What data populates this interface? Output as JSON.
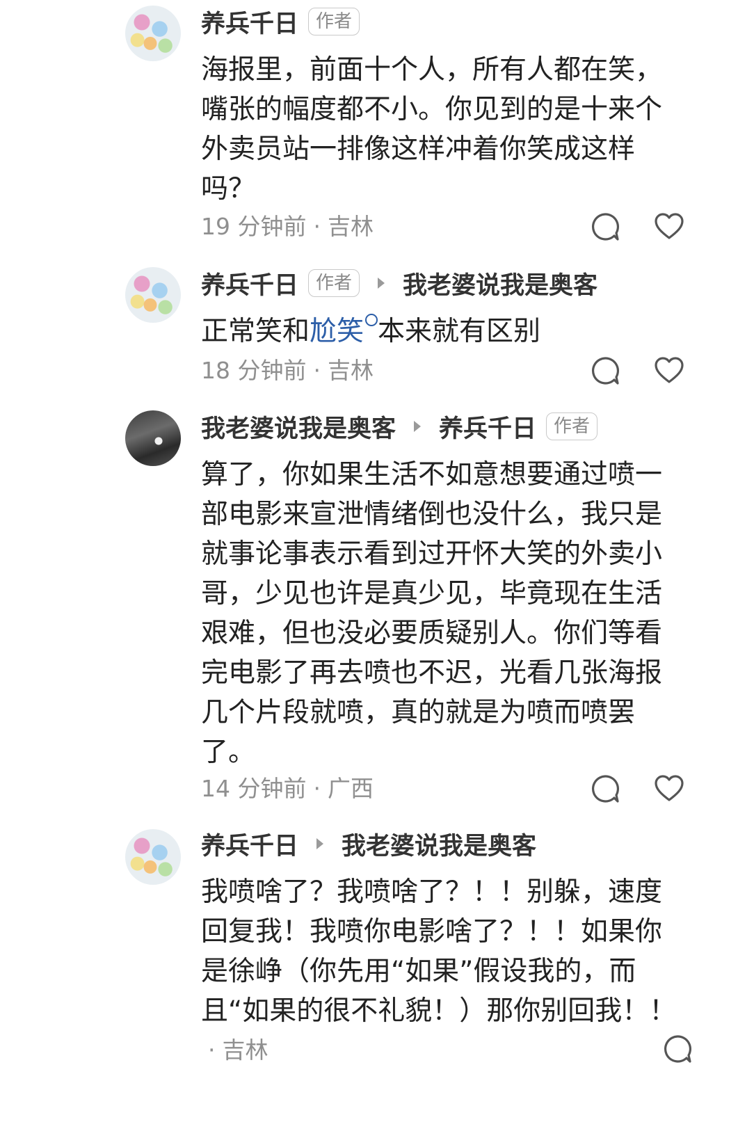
{
  "author_badge": "作者",
  "comments": [
    {
      "user": "养兵千日",
      "author_badge": true,
      "reply_to": "",
      "text": "海报里，前面十个人，所有人都在笑，嘴张的幅度都不小。你见到的是十来个外卖员站一排像这样冲着你笑成这样吗？",
      "time": "19 分钟前",
      "location": "吉林"
    },
    {
      "user": "养兵千日",
      "author_badge": true,
      "reply_to": "我老婆说我是奥客",
      "text_before": "正常笑和",
      "link": "尬笑",
      "text_after": "本来就有区别",
      "time": "18 分钟前",
      "location": "吉林"
    },
    {
      "user": "我老婆说我是奥客",
      "reply_to": "养兵千日",
      "reply_to_badge": true,
      "text": "算了，你如果生活不如意想要通过喷一部电影来宣泄情绪倒也没什么，我只是就事论事表示看到过开怀大笑的外卖小哥，少见也许是真少见，毕竟现在生活艰难，但也没必要质疑别人。你们等看完电影了再去喷也不迟，光看几张海报几个片段就喷，真的就是为喷而喷罢了。",
      "time": "14 分钟前",
      "location": "广西"
    },
    {
      "user": "养兵千日",
      "reply_to": "我老婆说我是奥客",
      "text": "我喷啥了？我喷啥了？！！别躲，速度回复我！我喷你电影啥了？！！如果你是徐峥（你先用“如果”假设我的，而且“如果的很不礼貌！）那你别回我！！",
      "time": "",
      "location": "吉林"
    }
  ],
  "separator": "·",
  "icons": {
    "reply": "comment-bubble-icon",
    "like": "heart-outline-icon",
    "reply_arrow": "reply-arrow-icon"
  },
  "colors": {
    "text": "#222222",
    "meta": "#8f8f8f",
    "link": "#2c5ea8",
    "badge_border": "#c9c9c9"
  }
}
